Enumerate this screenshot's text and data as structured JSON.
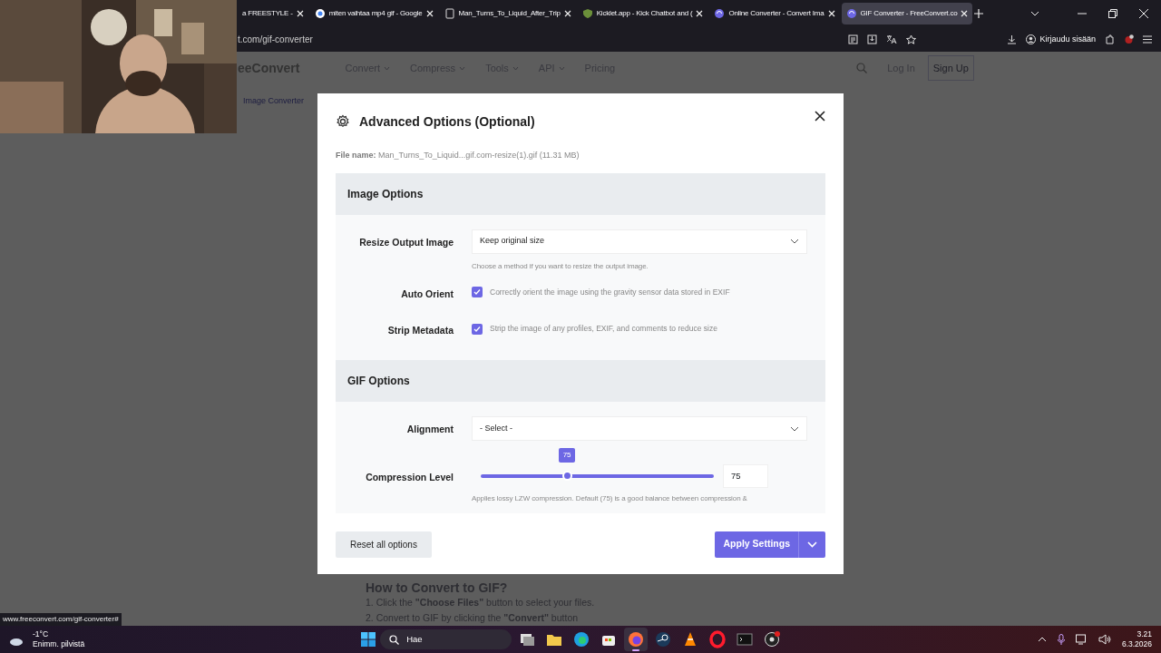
{
  "browser": {
    "tabs": [
      {
        "title": "a FREESTYLE - ",
        "selected": false
      },
      {
        "title": "miten vaihtaa mp4 gif - Google",
        "selected": false
      },
      {
        "title": "Man_Turns_To_Liquid_After_Trip",
        "selected": false
      },
      {
        "title": "Kicklet.app - Kick Chatbot and (",
        "selected": false
      },
      {
        "title": "Online Converter - Convert Ima",
        "selected": false
      },
      {
        "title": "GIF Converter - FreeConvert.co",
        "selected": true
      }
    ],
    "address": "t.com/gif-converter",
    "account_button": "Kirjaudu sisään"
  },
  "site": {
    "logo": "eeConvert",
    "nav": [
      "Convert",
      "Compress",
      "Tools",
      "API",
      "Pricing"
    ],
    "login": "Log In",
    "signup": "Sign Up",
    "breadcrumb": "Image Converter",
    "howto_title": "How to Convert to GIF?",
    "steps": [
      "1. Click the **\"Choose Files\"** button to select your files.",
      "2. Convert to GIF by clicking the **\"Convert\"** button"
    ]
  },
  "modal": {
    "title": "Advanced Options (Optional)",
    "file_label": "File name:",
    "file_name": "Man_Turns_To_Liquid...gif.com-resize(1).gif (11.31 MB)",
    "sections": [
      {
        "title": "Image Options",
        "rows": [
          {
            "kind": "select",
            "label": "Resize Output Image",
            "value": "Keep original size",
            "hint": "Choose a method if you want to resize the output image."
          },
          {
            "kind": "checkbox",
            "label": "Auto Orient",
            "checked": true,
            "text": "Correctly orient the image using the gravity sensor data stored in EXIF"
          },
          {
            "kind": "checkbox",
            "label": "Strip Metadata",
            "checked": true,
            "text": "Strip the image of any profiles, EXIF, and comments to reduce size"
          }
        ]
      },
      {
        "title": "GIF Options",
        "rows": [
          {
            "kind": "select",
            "label": "Alignment",
            "value": "- Select -"
          },
          {
            "kind": "slider",
            "label": "Compression Level",
            "level": 0.37,
            "bubble": "75",
            "value": "75",
            "hint": "Applies lossy LZW compression. Default (75) is a good balance between compression &"
          }
        ]
      }
    ],
    "reset_button": "Reset all options",
    "apply_button": "Apply Settings"
  },
  "status_url": "www.freeconvert.com/gif-converter#",
  "taskbar": {
    "weather_temp": "-1°C",
    "weather_text": "Enimm. pilvistä",
    "search": "Hae",
    "apps": [
      {
        "active": false
      },
      {
        "active": false
      },
      {
        "active": false
      },
      {
        "active": true
      },
      {
        "active": false
      },
      {
        "active": false
      },
      {
        "active": false
      },
      {
        "active": false
      },
      {
        "active": false
      }
    ],
    "time": "3.21",
    "date": "6.3.2026"
  }
}
